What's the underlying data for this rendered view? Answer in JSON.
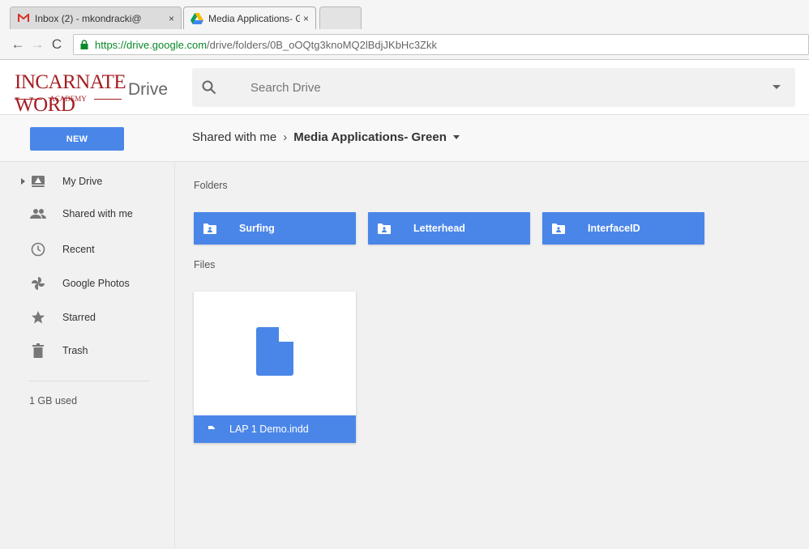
{
  "browser": {
    "tabs": [
      {
        "title": "Inbox (2) - mkondracki@",
        "icon": "gmail-icon",
        "close": "×"
      },
      {
        "title": "Media Applications- Gre",
        "icon": "drive-icon",
        "close": "×"
      }
    ],
    "nav": {
      "back": "←",
      "forward": "→",
      "reload": "C"
    },
    "url_host": "https://drive.google.com",
    "url_path": "/drive/folders/0B_oOQtg3knoMQ2lBdjJKbHc3Zkk"
  },
  "header": {
    "logo_main": "INCARNATE WORD",
    "logo_sub": "ACADEMY",
    "product": "Drive",
    "search_placeholder": "Search Drive"
  },
  "toolbar": {
    "new_label": "NEW",
    "breadcrumb_root": "Shared with me",
    "breadcrumb_sep": "›",
    "breadcrumb_current": "Media Applications- Green"
  },
  "sidebar": {
    "items": [
      {
        "label": "My Drive",
        "icon": "my-drive-icon"
      },
      {
        "label": "Shared with me",
        "icon": "people-icon"
      },
      {
        "label": "Recent",
        "icon": "clock-icon"
      },
      {
        "label": "Google Photos",
        "icon": "pinwheel-icon"
      },
      {
        "label": "Starred",
        "icon": "star-icon"
      },
      {
        "label": "Trash",
        "icon": "trash-icon"
      }
    ],
    "storage": "1 GB used"
  },
  "main": {
    "folders_label": "Folders",
    "files_label": "Files",
    "folders": [
      {
        "name": "Surfing"
      },
      {
        "name": "Letterhead"
      },
      {
        "name": "InterfaceID"
      }
    ],
    "files": [
      {
        "name": "LAP 1 Demo.indd",
        "icon": "document-icon"
      }
    ]
  },
  "colors": {
    "accent": "#4a86e8",
    "logo": "#a41e22"
  }
}
